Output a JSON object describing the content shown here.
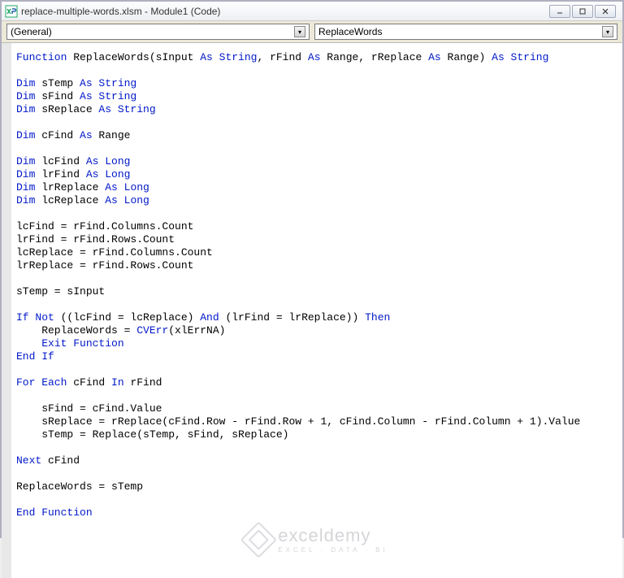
{
  "window": {
    "title": "replace-multiple-words.xlsm - Module1 (Code)"
  },
  "dropdowns": {
    "object": "(General)",
    "procedure": "ReplaceWords"
  },
  "code": {
    "tokens": [
      [
        [
          "kw",
          "Function"
        ],
        [
          "",
          " ReplaceWords(sInput "
        ],
        [
          "kw",
          "As String"
        ],
        [
          "",
          ", rFind "
        ],
        [
          "kw",
          "As"
        ],
        [
          "",
          " Range, rReplace "
        ],
        [
          "kw",
          "As"
        ],
        [
          "",
          " Range) "
        ],
        [
          "kw",
          "As String"
        ]
      ],
      [],
      [
        [
          "kw",
          "Dim"
        ],
        [
          "",
          " sTemp "
        ],
        [
          "kw",
          "As String"
        ]
      ],
      [
        [
          "kw",
          "Dim"
        ],
        [
          "",
          " sFind "
        ],
        [
          "kw",
          "As String"
        ]
      ],
      [
        [
          "kw",
          "Dim"
        ],
        [
          "",
          " sReplace "
        ],
        [
          "kw",
          "As String"
        ]
      ],
      [],
      [
        [
          "kw",
          "Dim"
        ],
        [
          "",
          " cFind "
        ],
        [
          "kw",
          "As"
        ],
        [
          "",
          " Range"
        ]
      ],
      [],
      [
        [
          "kw",
          "Dim"
        ],
        [
          "",
          " lcFind "
        ],
        [
          "kw",
          "As Long"
        ]
      ],
      [
        [
          "kw",
          "Dim"
        ],
        [
          "",
          " lrFind "
        ],
        [
          "kw",
          "As Long"
        ]
      ],
      [
        [
          "kw",
          "Dim"
        ],
        [
          "",
          " lrReplace "
        ],
        [
          "kw",
          "As Long"
        ]
      ],
      [
        [
          "kw",
          "Dim"
        ],
        [
          "",
          " lcReplace "
        ],
        [
          "kw",
          "As Long"
        ]
      ],
      [],
      [
        [
          "",
          "lcFind = rFind.Columns.Count"
        ]
      ],
      [
        [
          "",
          "lrFind = rFind.Rows.Count"
        ]
      ],
      [
        [
          "",
          "lcReplace = rFind.Columns.Count"
        ]
      ],
      [
        [
          "",
          "lrReplace = rFind.Rows.Count"
        ]
      ],
      [],
      [
        [
          "",
          "sTemp = sInput"
        ]
      ],
      [],
      [
        [
          "kw",
          "If Not"
        ],
        [
          "",
          " ((lcFind = lcReplace) "
        ],
        [
          "kw",
          "And"
        ],
        [
          "",
          " (lrFind = lrReplace)) "
        ],
        [
          "kw",
          "Then"
        ]
      ],
      [
        [
          "",
          "    ReplaceWords = "
        ],
        [
          "kw",
          "CVErr"
        ],
        [
          "",
          "(xlErrNA)"
        ]
      ],
      [
        [
          "",
          "    "
        ],
        [
          "kw",
          "Exit Function"
        ]
      ],
      [
        [
          "kw",
          "End If"
        ]
      ],
      [],
      [
        [
          "kw",
          "For Each"
        ],
        [
          "",
          " cFind "
        ],
        [
          "kw",
          "In"
        ],
        [
          "",
          " rFind"
        ]
      ],
      [],
      [
        [
          "",
          "    sFind = cFind.Value"
        ]
      ],
      [
        [
          "",
          "    sReplace = rReplace(cFind.Row - rFind.Row + 1, cFind.Column - rFind.Column + 1).Value"
        ]
      ],
      [
        [
          "",
          "    sTemp = Replace(sTemp, sFind, sReplace)"
        ]
      ],
      [],
      [
        [
          "kw",
          "Next"
        ],
        [
          "",
          " cFind"
        ]
      ],
      [],
      [
        [
          "",
          "ReplaceWords = sTemp"
        ]
      ],
      [],
      [
        [
          "kw",
          "End Function"
        ]
      ]
    ]
  },
  "watermark": {
    "main": "exceldemy",
    "sub": "EXCEL · DATA · BI"
  }
}
